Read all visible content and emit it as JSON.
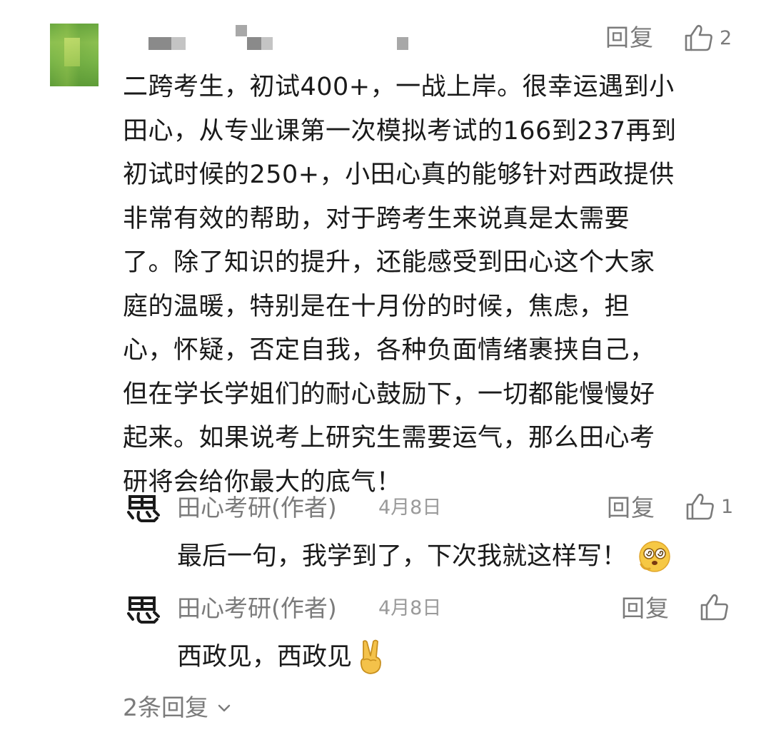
{
  "comment": {
    "username_blurred": true,
    "reply_label": "回复",
    "like_count": "2",
    "text_lines": [
      "二跨考生，初试400+，一战上岸。很幸运遇到小",
      "田心，从专业课第一次模拟考试的166到237再到",
      "初试时候的250+，小田心真的能够针对西政提供",
      "非常有效的帮助，对于跨考生来说真是太需要",
      "了。除了知识的提升，还能感受到田心这个大家",
      "庭的温暖，特别是在十月份的时候，焦虑，担",
      "心，怀疑，否定自我，各种负面情绪裹挟自己，",
      "但在学长学姐们的耐心鼓励下，一切都能慢慢好",
      "起来。如果说考上研究生需要运气，那么田心考",
      "研将会给你最大的底气！"
    ]
  },
  "replies": [
    {
      "author": "田心考研(作者)",
      "date": "4月8日",
      "reply_label": "回复",
      "like_count": "1",
      "text": "最后一句，我学到了，下次我就这样写！",
      "emoji": "dizzy-face-emoji"
    },
    {
      "author": "田心考研(作者)",
      "date": "4月8日",
      "reply_label": "回复",
      "like_count": "",
      "text": "西政见，西政见",
      "emoji": "victory-hand-emoji"
    }
  ],
  "more_replies": "2条回复",
  "colors": {
    "text": "#1a1a1a",
    "muted": "#7b7b7b",
    "date": "#9a9a9a",
    "avatar": "#7ab548"
  }
}
